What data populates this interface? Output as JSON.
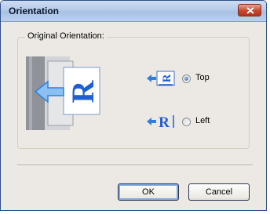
{
  "window": {
    "title": "Orientation"
  },
  "group": {
    "label": "Original Orientation:"
  },
  "options": [
    {
      "label": "Top",
      "selected": true,
      "icon": "portrait-arrow-icon"
    },
    {
      "label": "Left",
      "selected": false,
      "icon": "landscape-arrow-icon"
    }
  ],
  "buttons": {
    "ok": "OK",
    "cancel": "Cancel"
  },
  "colors": {
    "accent": "#1f5fd6",
    "arrow": "#2f7fe0",
    "title_bar": "#b5cbe9"
  }
}
